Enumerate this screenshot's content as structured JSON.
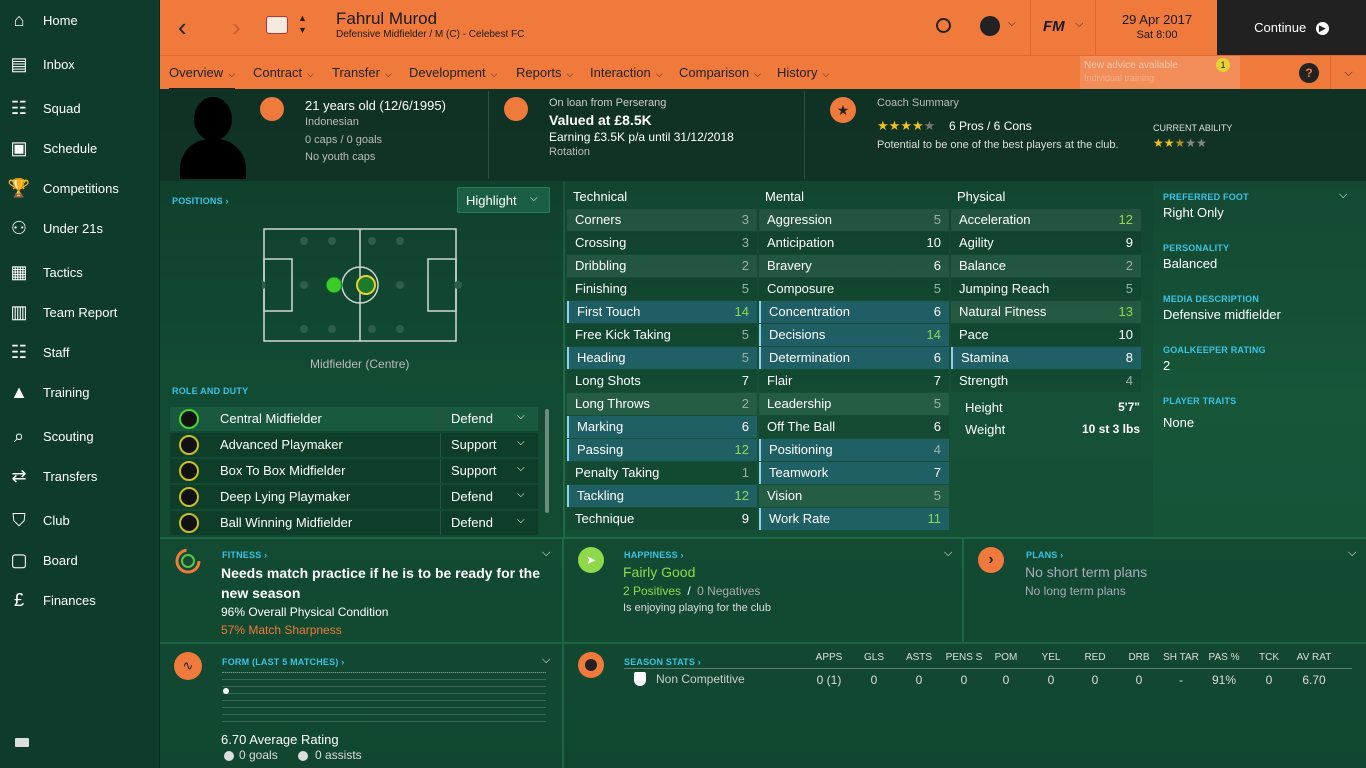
{
  "sidebar": {
    "items": [
      {
        "label": "Home",
        "icon": "home-icon"
      },
      {
        "label": "Inbox",
        "icon": "inbox-icon"
      },
      {
        "label": "Squad",
        "icon": "squad-icon"
      },
      {
        "label": "Schedule",
        "icon": "calendar-icon"
      },
      {
        "label": "Competitions",
        "icon": "trophy-icon"
      },
      {
        "label": "Under 21s",
        "icon": "u21-icon",
        "badge": "U21"
      },
      {
        "label": "Tactics",
        "icon": "tactics-icon"
      },
      {
        "label": "Team Report",
        "icon": "report-icon"
      },
      {
        "label": "Staff",
        "icon": "staff-icon"
      },
      {
        "label": "Training",
        "icon": "training-icon"
      },
      {
        "label": "Scouting",
        "icon": "search-icon"
      },
      {
        "label": "Transfers",
        "icon": "transfer-icon"
      },
      {
        "label": "Club",
        "icon": "shield-icon"
      },
      {
        "label": "Board",
        "icon": "briefcase-icon"
      },
      {
        "label": "Finances",
        "icon": "money-icon"
      }
    ]
  },
  "header": {
    "player_name": "Fahrul Murod",
    "player_sub": "Defensive Midfielder / M (C) - Celebest FC",
    "date": "29 Apr 2017",
    "time": "Sat 8:00",
    "continue": "Continue",
    "fm_logo": "FM",
    "advice_title": "New advice available",
    "advice_sub": "Individual training",
    "advice_count": "1"
  },
  "tabs": [
    "Overview",
    "Contract",
    "Transfer",
    "Development",
    "Reports",
    "Interaction",
    "Comparison",
    "History"
  ],
  "info": {
    "age": "21 years old (12/6/1995)",
    "nationality": "Indonesian",
    "caps": "0 caps / 0 goals",
    "youth": "No youth caps",
    "loan": "On loan from Perserang",
    "value": "Valued at £8.5K",
    "earning": "Earning £3.5K p/a until 31/12/2018",
    "status": "Rotation",
    "coach_title": "Coach Summary",
    "pros_cons": "6 Pros / 6 Cons",
    "coach_stars": 4,
    "potential": "Potential to be one of the best players at the club.",
    "ca_label": "CURRENT ABILITY",
    "ca_stars": 2.5
  },
  "positions": {
    "header": "POSITIONS",
    "highlight": "Highlight",
    "pos_label": "Midfielder (Centre)",
    "role_header": "ROLE AND DUTY",
    "roles": [
      {
        "role": "Central Midfielder",
        "duty": "Defend"
      },
      {
        "role": "Advanced Playmaker",
        "duty": "Support"
      },
      {
        "role": "Box To Box Midfielder",
        "duty": "Support"
      },
      {
        "role": "Deep Lying Playmaker",
        "duty": "Defend"
      },
      {
        "role": "Ball Winning Midfielder",
        "duty": "Defend"
      }
    ]
  },
  "attributes": {
    "technical_title": "Technical",
    "mental_title": "Mental",
    "physical_title": "Physical",
    "technical": [
      [
        "Corners",
        "3"
      ],
      [
        "Crossing",
        "3"
      ],
      [
        "Dribbling",
        "2"
      ],
      [
        "Finishing",
        "5"
      ],
      [
        "First Touch",
        "14"
      ],
      [
        "Free Kick Taking",
        "5"
      ],
      [
        "Heading",
        "5"
      ],
      [
        "Long Shots",
        "7"
      ],
      [
        "Long Throws",
        "2"
      ],
      [
        "Marking",
        "6"
      ],
      [
        "Passing",
        "12"
      ],
      [
        "Penalty Taking",
        "1"
      ],
      [
        "Tackling",
        "12"
      ],
      [
        "Technique",
        "9"
      ]
    ],
    "mental": [
      [
        "Aggression",
        "5"
      ],
      [
        "Anticipation",
        "10"
      ],
      [
        "Bravery",
        "6"
      ],
      [
        "Composure",
        "5"
      ],
      [
        "Concentration",
        "6"
      ],
      [
        "Decisions",
        "14"
      ],
      [
        "Determination",
        "6"
      ],
      [
        "Flair",
        "7"
      ],
      [
        "Leadership",
        "5"
      ],
      [
        "Off The Ball",
        "6"
      ],
      [
        "Positioning",
        "4"
      ],
      [
        "Teamwork",
        "7"
      ],
      [
        "Vision",
        "5"
      ],
      [
        "Work Rate",
        "11"
      ]
    ],
    "physical": [
      [
        "Acceleration",
        "12"
      ],
      [
        "Agility",
        "9"
      ],
      [
        "Balance",
        "2"
      ],
      [
        "Jumping Reach",
        "5"
      ],
      [
        "Natural Fitness",
        "13"
      ],
      [
        "Pace",
        "10"
      ],
      [
        "Stamina",
        "8"
      ],
      [
        "Strength",
        "4"
      ]
    ],
    "height_label": "Height",
    "height": "5'7\"",
    "weight_label": "Weight",
    "weight": "10 st 3 lbs"
  },
  "side": {
    "pref_foot_h": "PREFERRED FOOT",
    "pref_foot": "Right Only",
    "personality_h": "PERSONALITY",
    "personality": "Balanced",
    "media_h": "MEDIA DESCRIPTION",
    "media": "Defensive midfielder",
    "gk_h": "GOALKEEPER RATING",
    "gk": "2",
    "traits_h": "PLAYER TRAITS",
    "traits": "None"
  },
  "fitness": {
    "h": "FITNESS",
    "line1": "Needs match practice if he is to be ready for the",
    "line2": "new season",
    "cond": "96% Overall Physical Condition",
    "sharp": "57% Match Sharpness"
  },
  "happiness": {
    "h": "HAPPINESS",
    "status": "Fairly Good",
    "pos": "2 Positives",
    "sep": "/",
    "neg": "0 Negatives",
    "note": "Is enjoying playing for the club"
  },
  "plans": {
    "h": "PLANS",
    "a": "No short term plans",
    "b": "No long term plans"
  },
  "form": {
    "h": "FORM (LAST 5 MATCHES)",
    "avg": "6.70 Average Rating",
    "goals": "0 goals",
    "assists": "0 assists"
  },
  "season": {
    "h": "SEASON STATS",
    "cols": [
      "APPS",
      "GLS",
      "ASTS",
      "PENS S",
      "POM",
      "YEL",
      "RED",
      "DRB",
      "SH TAR",
      "PAS %",
      "TCK",
      "AV RAT"
    ],
    "row_label": "Non Competitive",
    "row": [
      "0 (1)",
      "0",
      "0",
      "0",
      "0",
      "0",
      "0",
      "0",
      "-",
      "91%",
      "0",
      "6.70"
    ]
  },
  "colors": {
    "accent": "#f07a3c",
    "green": "#8ed94b",
    "blue_hdr": "#39c3e6"
  }
}
